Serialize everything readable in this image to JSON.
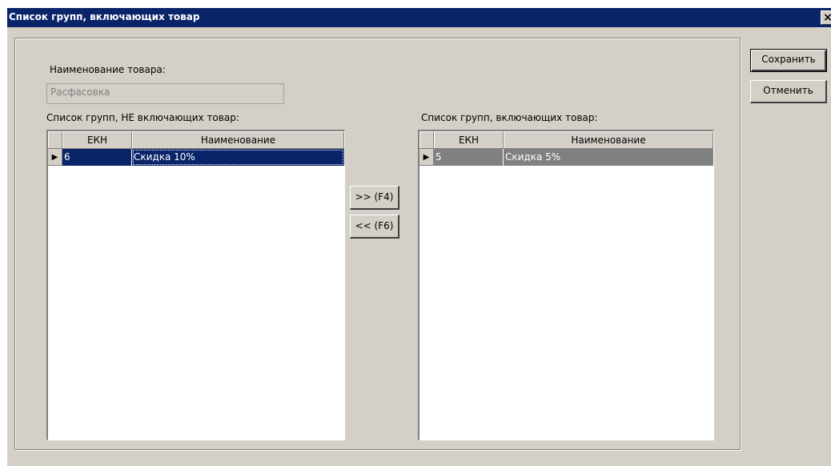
{
  "window": {
    "title": "Список групп, включающих товар",
    "close_glyph": "✕",
    "close_label": "×"
  },
  "product": {
    "label": "Наименование товара:",
    "value": "Расфасовка"
  },
  "left_list": {
    "label": "Список групп, НЕ включающих товар:",
    "columns": [
      "ЕКН",
      "Наименование"
    ],
    "rows": [
      {
        "code": "6",
        "name": "Скидка 10%",
        "selected": true
      }
    ]
  },
  "right_list": {
    "label": "Список групп, включающих товар:",
    "columns": [
      "ЕКН",
      "Наименование"
    ],
    "rows": [
      {
        "code": "5",
        "name": "Скидка 5%",
        "selected": true
      }
    ]
  },
  "transfer": {
    "add_label": ">> (F4)",
    "remove_label": "<< (F6)"
  },
  "actions": {
    "save_label": "Сохранить",
    "cancel_label": "Отменить"
  },
  "row_indicator": "▶",
  "colors": {
    "titlebar": "#0a246a",
    "selection_active": "#0a246a",
    "selection_inactive": "#808080",
    "face": "#d4d0c8"
  }
}
